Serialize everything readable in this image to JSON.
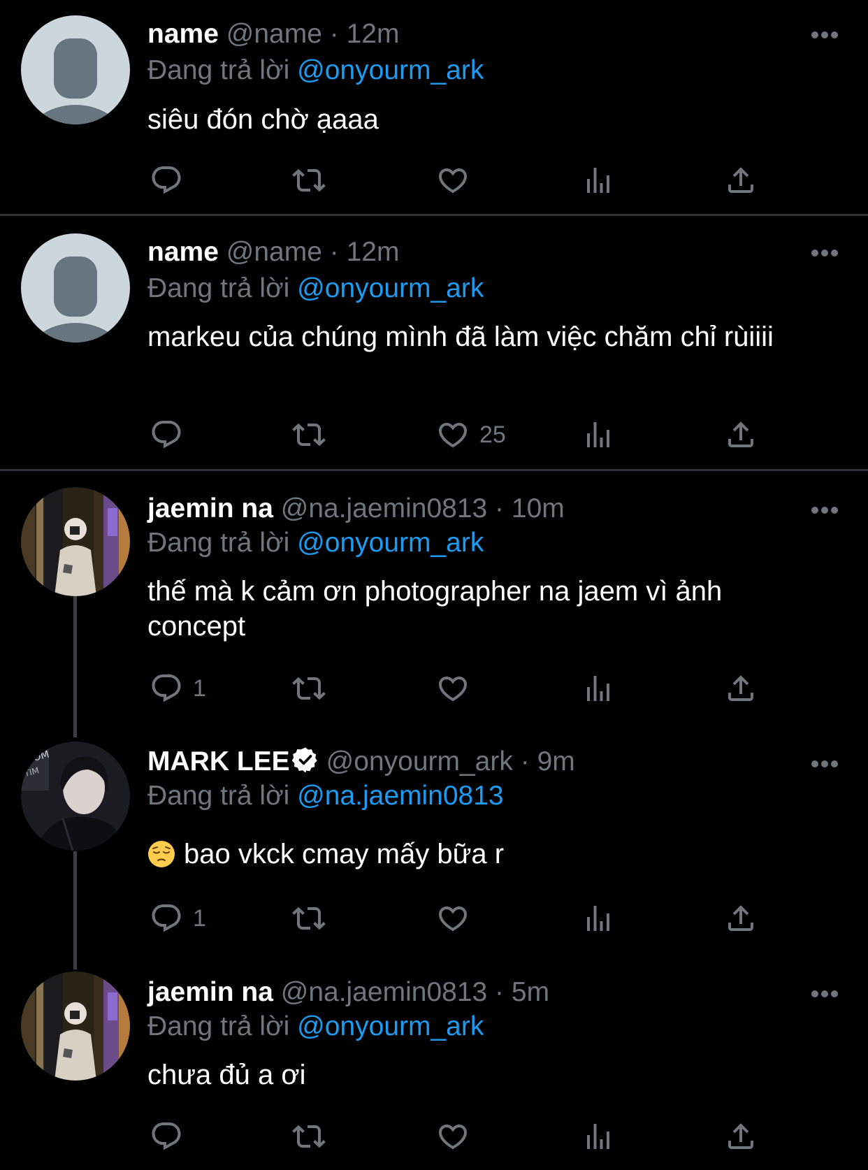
{
  "tweets": [
    {
      "name": "name",
      "handle": "@name",
      "separator": "·",
      "time": "12m",
      "replying_prefix": "Đang trả lời",
      "replying_to": "@onyourm_ark",
      "text": "siêu đón chờ ạaaa",
      "reply_count": "",
      "like_count": ""
    },
    {
      "name": "name",
      "handle": "@name",
      "separator": "·",
      "time": "12m",
      "replying_prefix": "Đang trả lời",
      "replying_to": "@onyourm_ark",
      "text": "markeu của chúng mình đã làm việc chăm chỉ rùiiii",
      "reply_count": "",
      "like_count": "25"
    },
    {
      "name": "jaemin na",
      "handle": "@na.jaemin0813",
      "separator": "·",
      "time": "10m",
      "replying_prefix": "Đang trả lời",
      "replying_to": "@onyourm_ark",
      "text": "thế mà k cảm ơn photographer na jaem vì ảnh concept",
      "reply_count": "1",
      "like_count": ""
    },
    {
      "name": "MARK LEE",
      "verified": true,
      "handle": "@onyourm_ark",
      "separator": "·",
      "time": "9m",
      "replying_prefix": "Đang trả lời",
      "replying_to": "@na.jaemin0813",
      "emoji": "pensive-face",
      "text": "bao vkck cmay mấy bữa r",
      "reply_count": "1",
      "like_count": ""
    },
    {
      "name": "jaemin na",
      "handle": "@na.jaemin0813",
      "separator": "·",
      "time": "5m",
      "replying_prefix": "Đang trả lời",
      "replying_to": "@onyourm_ark",
      "text": "chưa đủ a ơi",
      "reply_count": "",
      "like_count": ""
    }
  ],
  "icons": {
    "reply": "reply-icon",
    "retweet": "retweet-icon",
    "like": "like-icon",
    "views": "views-icon",
    "share": "share-icon",
    "more": "more-icon",
    "verified": "verified-badge-icon"
  },
  "colors": {
    "background": "#000000",
    "text": "#ffffff",
    "secondary": "#71767b",
    "link": "#1d9bf0",
    "divider": "#2f3336"
  }
}
